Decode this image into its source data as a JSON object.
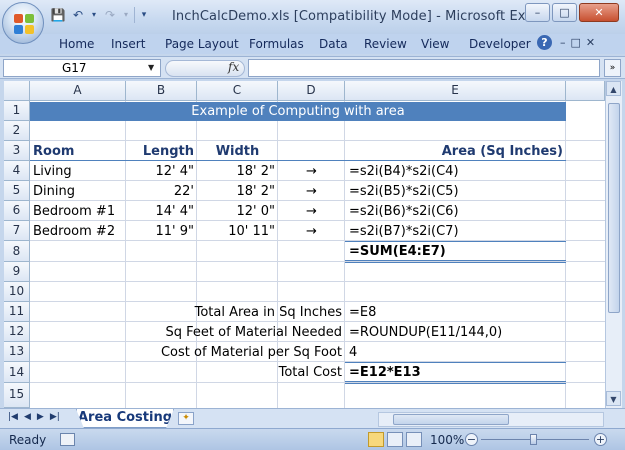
{
  "window": {
    "title": "InchCalcDemo.xls  [Compatibility Mode] - Microsoft Excel",
    "controls": {
      "minimize": "–",
      "maximize": "□",
      "close": "✕"
    }
  },
  "quick_access": {
    "save_icon": "save-icon",
    "undo_icon": "undo-icon",
    "redo_icon": "redo-icon",
    "customize_icon": "dropdown-icon"
  },
  "ribbon": {
    "tabs": [
      "Home",
      "Insert",
      "Page Layout",
      "Formulas",
      "Data",
      "Review",
      "View",
      "Developer"
    ],
    "help": "?",
    "mini_controls": [
      "–",
      "□",
      "✕"
    ]
  },
  "formula_bar": {
    "name_box": "G17",
    "fx": "fx",
    "formula": ""
  },
  "columns": [
    "A",
    "B",
    "C",
    "D",
    "E"
  ],
  "rows": [
    "1",
    "2",
    "3",
    "4",
    "5",
    "6",
    "7",
    "8",
    "9",
    "10",
    "11",
    "12",
    "13",
    "14",
    "15"
  ],
  "sheet": {
    "banner": "Example of Computing with area",
    "headers": {
      "room": "Room",
      "length": "Length",
      "width": "Width",
      "area": "Area (Sq Inches)"
    },
    "data_rows": [
      {
        "room": "Living",
        "length": "12' 4\"",
        "width": "18' 2\"",
        "arrow": "→",
        "area": "=s2i(B4)*s2i(C4)"
      },
      {
        "room": "Dining",
        "length": "22'",
        "width": "18' 2\"",
        "arrow": "→",
        "area": "=s2i(B5)*s2i(C5)"
      },
      {
        "room": "Bedroom #1",
        "length": "14' 4\"",
        "width": "12' 0\"",
        "arrow": "→",
        "area": "=s2i(B6)*s2i(C6)"
      },
      {
        "room": "Bedroom #2",
        "length": "11' 9\"",
        "width": "10' 11\"",
        "arrow": "→",
        "area": "=s2i(B7)*s2i(C7)"
      }
    ],
    "sum_formula": "=SUM(E4:E7)",
    "summary": [
      {
        "label": "Total Area in Sq Inches",
        "value": "=E8"
      },
      {
        "label": "Sq Feet of Material Needed",
        "value": "=ROUNDUP(E11/144,0)"
      },
      {
        "label": "Cost of Material per Sq Foot",
        "value": "4"
      },
      {
        "label": "Total Cost",
        "value": "=E12*E13"
      }
    ]
  },
  "sheet_tabs": {
    "nav": [
      "|◀",
      "◀",
      "▶",
      "▶|"
    ],
    "active": "Area Costing"
  },
  "status_bar": {
    "status": "Ready",
    "zoom": "100%",
    "zoom_out": "−",
    "zoom_in": "+"
  }
}
